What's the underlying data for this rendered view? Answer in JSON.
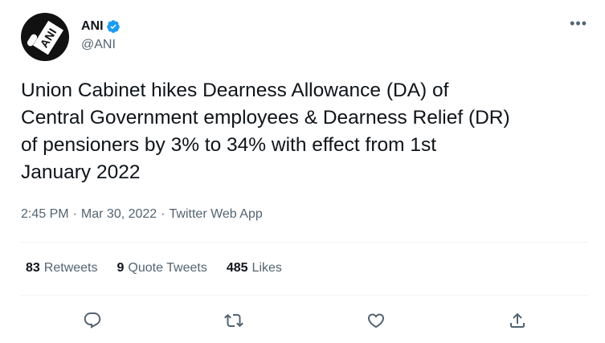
{
  "author": {
    "display_name": "ANI",
    "handle": "@ANI",
    "avatar_text": "ANI",
    "verified": true
  },
  "more_icon": "more-options-icon",
  "tweet": {
    "text": "Union Cabinet hikes Dearness Allowance (DA) of\nCentral Government employees & Dearness Relief (DR)\nof pensioners by 3% to 34% with effect from 1st\nJanuary 2022"
  },
  "meta": {
    "time": "2:45 PM",
    "sep1": "·",
    "date": "Mar 30, 2022",
    "sep2": "·",
    "app": "Twitter Web App"
  },
  "stats": {
    "retweets": {
      "count": "83",
      "label": "Retweets"
    },
    "quotes": {
      "count": "9",
      "label": "Quote Tweets"
    },
    "likes": {
      "count": "485",
      "label": "Likes"
    }
  },
  "actions": {
    "reply_icon": "reply-icon",
    "retweet_icon": "retweet-icon",
    "like_icon": "heart-icon",
    "share_icon": "share-icon"
  },
  "colors": {
    "text": "#0f1419",
    "secondary": "#536471",
    "verified": "#1d9bf0",
    "divider": "#eff3f4"
  }
}
